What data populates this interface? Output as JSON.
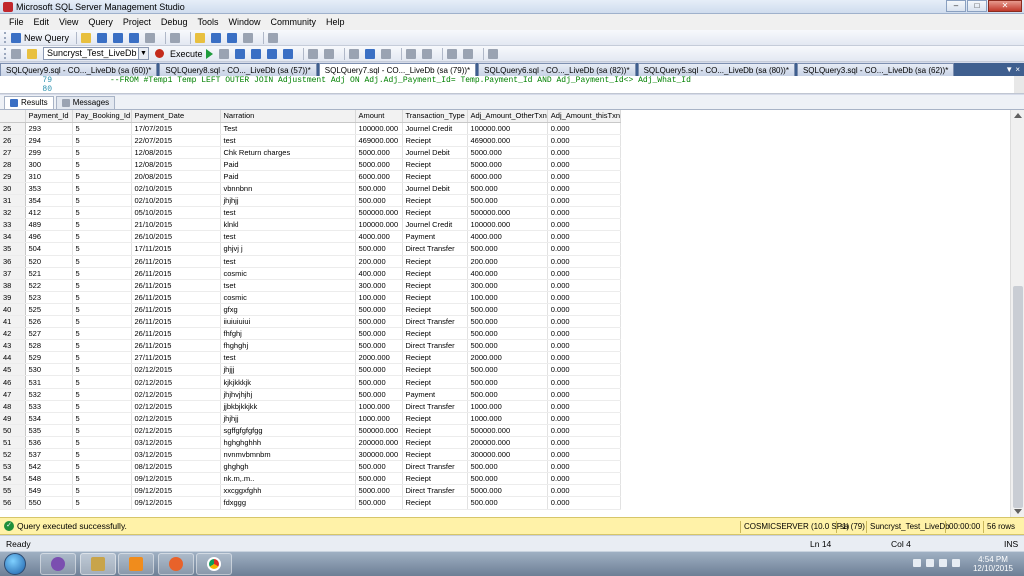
{
  "window": {
    "title": "Microsoft SQL Server Management Studio"
  },
  "menu": [
    "File",
    "Edit",
    "View",
    "Query",
    "Project",
    "Debug",
    "Tools",
    "Window",
    "Community",
    "Help"
  ],
  "toolbar": {
    "new_query_label": "New Query",
    "database": "Suncryst_Test_LiveDb",
    "execute_label": "Execute"
  },
  "tabs": [
    "SQLQuery9.sql - CO..._LiveDb (sa (60))*",
    "SQLQuery8.sql - CO..._LiveDb (sa (57))*",
    "SQLQuery7.sql - CO..._LiveDb (sa (79))*",
    "SQLQuery6.sql - CO..._LiveDb (sa (82))*",
    "SQLQuery5.sql - CO..._LiveDb (sa (80))*",
    "SQLQuery3.sql - CO..._LiveDb (sa (62))*"
  ],
  "tabs_close": "▼ ×",
  "editor": {
    "line_numbers": "79\n80",
    "code": "--FROM #Temp1 Temp LEFT OUTER JOIN Adjustment Adj ON Adj.Adj_Payment_Id= Temp.Payment_Id AND Adj_Payment_Id<> Adj_What_Id"
  },
  "result_tabs": {
    "results": "Results",
    "messages": "Messages"
  },
  "grid": {
    "columns": [
      "",
      "Payment_Id",
      "Pay_Booking_Id",
      "Payment_Date",
      "Narration",
      "Amount",
      "Transaction_Type",
      "Adj_Amount_OtherTxn",
      "Adj_Amount_thisTxn"
    ],
    "rows": [
      [
        "25",
        "293",
        "5",
        "17/07/2015",
        "Test",
        "100000.000",
        "Journel Credit",
        "100000.000",
        "0.000"
      ],
      [
        "26",
        "294",
        "5",
        "22/07/2015",
        "test",
        "469000.000",
        "Reciept",
        "469000.000",
        "0.000"
      ],
      [
        "27",
        "299",
        "5",
        "12/08/2015",
        "Chk Return charges",
        "5000.000",
        "Journel Debit",
        "5000.000",
        "0.000"
      ],
      [
        "28",
        "300",
        "5",
        "12/08/2015",
        "Paid",
        "5000.000",
        "Reciept",
        "5000.000",
        "0.000"
      ],
      [
        "29",
        "310",
        "5",
        "20/08/2015",
        "Paid",
        "6000.000",
        "Reciept",
        "6000.000",
        "0.000"
      ],
      [
        "30",
        "353",
        "5",
        "02/10/2015",
        "vbnnbnn",
        "500.000",
        "Journel Debit",
        "500.000",
        "0.000"
      ],
      [
        "31",
        "354",
        "5",
        "02/10/2015",
        "jhjhjj",
        "500.000",
        "Reciept",
        "500.000",
        "0.000"
      ],
      [
        "32",
        "412",
        "5",
        "05/10/2015",
        "test",
        "500000.000",
        "Reciept",
        "500000.000",
        "0.000"
      ],
      [
        "33",
        "489",
        "5",
        "21/10/2015",
        "klnkl",
        "100000.000",
        "Journel Credit",
        "100000.000",
        "0.000"
      ],
      [
        "34",
        "496",
        "5",
        "26/10/2015",
        "test",
        "4000.000",
        "Payment",
        "4000.000",
        "0.000"
      ],
      [
        "35",
        "504",
        "5",
        "17/11/2015",
        "ghjvj j",
        "500.000",
        "Direct Transfer",
        "500.000",
        "0.000"
      ],
      [
        "36",
        "520",
        "5",
        "26/11/2015",
        "test",
        "200.000",
        "Reciept",
        "200.000",
        "0.000"
      ],
      [
        "37",
        "521",
        "5",
        "26/11/2015",
        "cosmic",
        "400.000",
        "Reciept",
        "400.000",
        "0.000"
      ],
      [
        "38",
        "522",
        "5",
        "26/11/2015",
        "tset",
        "300.000",
        "Reciept",
        "300.000",
        "0.000"
      ],
      [
        "39",
        "523",
        "5",
        "26/11/2015",
        "cosmic",
        "100.000",
        "Reciept",
        "100.000",
        "0.000"
      ],
      [
        "40",
        "525",
        "5",
        "26/11/2015",
        "gfxg",
        "500.000",
        "Reciept",
        "500.000",
        "0.000"
      ],
      [
        "41",
        "526",
        "5",
        "26/11/2015",
        "iiuiuiuiui",
        "500.000",
        "Direct Transfer",
        "500.000",
        "0.000"
      ],
      [
        "42",
        "527",
        "5",
        "26/11/2015",
        "fhfghj",
        "500.000",
        "Reciept",
        "500.000",
        "0.000"
      ],
      [
        "43",
        "528",
        "5",
        "26/11/2015",
        "fhghghj",
        "500.000",
        "Direct Transfer",
        "500.000",
        "0.000"
      ],
      [
        "44",
        "529",
        "5",
        "27/11/2015",
        "test",
        "2000.000",
        "Reciept",
        "2000.000",
        "0.000"
      ],
      [
        "45",
        "530",
        "5",
        "02/12/2015",
        "jhjjj",
        "500.000",
        "Reciept",
        "500.000",
        "0.000"
      ],
      [
        "46",
        "531",
        "5",
        "02/12/2015",
        "kjkjkkkjk",
        "500.000",
        "Reciept",
        "500.000",
        "0.000"
      ],
      [
        "47",
        "532",
        "5",
        "02/12/2015",
        "jhjhvjhjhj",
        "500.000",
        "Payment",
        "500.000",
        "0.000"
      ],
      [
        "48",
        "533",
        "5",
        "02/12/2015",
        "jjbkbjkkjkk",
        "1000.000",
        "Direct Transfer",
        "1000.000",
        "0.000"
      ],
      [
        "49",
        "534",
        "5",
        "02/12/2015",
        "jhjhjj",
        "1000.000",
        "Reciept",
        "1000.000",
        "0.000"
      ],
      [
        "50",
        "535",
        "5",
        "02/12/2015",
        "sgffgfgfgfgg",
        "500000.000",
        "Reciept",
        "500000.000",
        "0.000"
      ],
      [
        "51",
        "536",
        "5",
        "03/12/2015",
        "hghghghhh",
        "200000.000",
        "Reciept",
        "200000.000",
        "0.000"
      ],
      [
        "52",
        "537",
        "5",
        "03/12/2015",
        "nvnmvbmnbm",
        "300000.000",
        "Reciept",
        "300000.000",
        "0.000"
      ],
      [
        "53",
        "542",
        "5",
        "08/12/2015",
        "ghghgh",
        "500.000",
        "Direct Transfer",
        "500.000",
        "0.000"
      ],
      [
        "54",
        "548",
        "5",
        "09/12/2015",
        "nk.m,.m..",
        "500.000",
        "Reciept",
        "500.000",
        "0.000"
      ],
      [
        "55",
        "549",
        "5",
        "09/12/2015",
        "xxcggxfghh",
        "5000.000",
        "Direct Transfer",
        "5000.000",
        "0.000"
      ],
      [
        "56",
        "550",
        "5",
        "09/12/2015",
        "fdxggg",
        "500.000",
        "Reciept",
        "500.000",
        "0.000"
      ]
    ]
  },
  "query_status": {
    "message": "Query executed successfully.",
    "server": "COSMICSERVER (10.0 SP1)",
    "user": "sa (79)",
    "database": "Suncryst_Test_LiveDb",
    "elapsed": "00:00:00",
    "rows": "56 rows"
  },
  "status": {
    "ready": "Ready",
    "ln": "Ln 14",
    "col": "Col 4",
    "ins": "INS"
  },
  "clock": {
    "time": "4:54 PM",
    "date": "12/10/2015"
  },
  "colors": {
    "status_bar": "#fff2a8",
    "tab_strip": "#3f5f8f",
    "comment": "#008000"
  }
}
